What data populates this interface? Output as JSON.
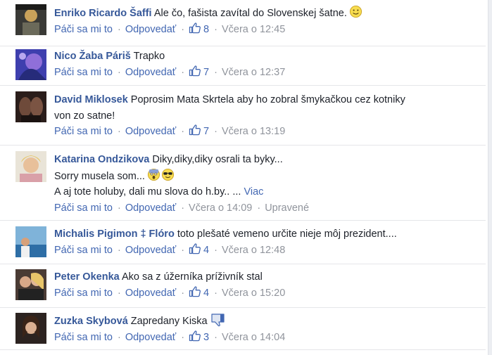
{
  "common": {
    "like_label": "Páči sa mi to",
    "reply_label": "Odpovedať",
    "more_label": "Viac",
    "edited_label": "Upravené",
    "link_color": "#4267b2",
    "author_color": "#365899",
    "meta_color": "#90949c"
  },
  "comments": [
    {
      "author": "Enriko Ricardo Šaffi",
      "lines": [
        "Ale čo, fašista zavítal do Slovenskej šatne."
      ],
      "likes": "8",
      "time": "Včera o 12:45"
    },
    {
      "author": "Nico Žaba Páriš",
      "lines": [
        "Trapko"
      ],
      "likes": "7",
      "time": "Včera o 12:37"
    },
    {
      "author": "David Miklosek",
      "lines": [
        "Poprosim Mata Skrtela aby ho zobral šmykačkou cez kotniky",
        "von zo satne!"
      ],
      "likes": "7",
      "time": "Včera o 13:19"
    },
    {
      "author": "Katarina Ondzikova",
      "lines": [
        "Diky,diky,diky osrali ta byky...",
        "Sorry musela som...",
        "A aj tote holuby, dali mu slova do h.by.. ..."
      ],
      "time": "Včera o 14:09"
    },
    {
      "author": "Michalis Pigimon ‡ Flóro",
      "lines": [
        "toto plešaté vemeno určite nieje môj prezident...."
      ],
      "likes": "4",
      "time": "Včera o 12:48"
    },
    {
      "author": "Peter Okenka",
      "lines": [
        "Ako sa z úžerníka príživník stal"
      ],
      "likes": "4",
      "time": "Včera o 15:20"
    },
    {
      "author": "Zuzka Skybová",
      "lines": [
        "Zapredany Kiska"
      ],
      "likes": "3",
      "time": "Včera o 14:04"
    }
  ]
}
